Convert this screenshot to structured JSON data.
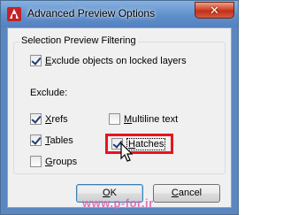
{
  "window": {
    "title": "Advanced Preview Options",
    "close_symbol": "✕",
    "app_icon": "autocad-icon"
  },
  "group": {
    "title": "Selection Preview Filtering",
    "locked_layers": {
      "pre": "",
      "key": "E",
      "post": "xclude objects on locked layers",
      "checked": true
    },
    "exclude_label": "Exclude:",
    "xrefs": {
      "pre": "",
      "key": "X",
      "post": "refs",
      "checked": true
    },
    "tables": {
      "pre": "",
      "key": "T",
      "post": "ables",
      "checked": true
    },
    "groups": {
      "pre": "",
      "key": "G",
      "post": "roups",
      "checked": false
    },
    "multiline": {
      "pre": "",
      "key": "M",
      "post": "ultiline text",
      "checked": false
    },
    "hatches": {
      "pre": "",
      "key": "H",
      "post": "atches",
      "checked": true
    }
  },
  "buttons": {
    "ok": {
      "key": "O",
      "post": "K"
    },
    "cancel": {
      "key": "C",
      "post": "ancel"
    }
  },
  "watermark": "www.p-for.ir",
  "colors": {
    "highlight": "#e8141e",
    "check": "#1d3b78",
    "title_bar": "#5f8fcb"
  }
}
